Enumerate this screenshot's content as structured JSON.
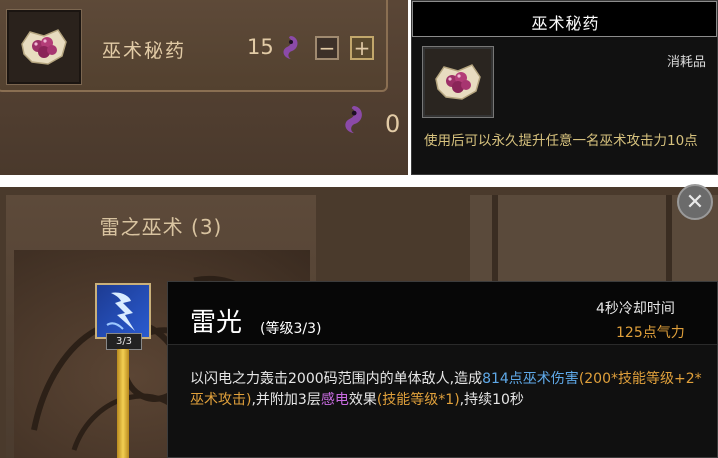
{
  "shop": {
    "item_name": "巫术秘药",
    "item_count": "15",
    "minus_label": "−",
    "plus_label": "+",
    "total_cost": "0",
    "currency_icon": "purple-swirl-icon",
    "item_icon": "potion-pouch-icon"
  },
  "item_tooltip": {
    "title": "巫术秘药",
    "type": "消耗品",
    "description": "使用后可以永久提升任意一名巫术攻击力10点"
  },
  "skill_panel": {
    "school_title": "雷之巫术 (3)",
    "close_label": "✕",
    "skill_icon": "lightning-skill-icon",
    "level_badge": "3/3"
  },
  "skill_tooltip": {
    "name": "雷光",
    "level": "(等级3/3)",
    "cooldown": "4秒冷却时间",
    "energy_cost": "125点气力",
    "desc_1": "以闪电之力轰击2000码范围内的单体敌人,造成",
    "desc_2": "814点巫术伤害",
    "desc_3": "(200*技能等级+2*巫术攻击)",
    "desc_4": ",并附加3层",
    "desc_5": "感电",
    "desc_6": "效果",
    "desc_7": "(技能等级*1)",
    "desc_8": ",持续10秒"
  },
  "colors": {
    "accent_orange": "#e0a03b",
    "damage_blue": "#5fa9e8",
    "effect_purple": "#c86be0",
    "desc_gold": "#d7c27e"
  }
}
